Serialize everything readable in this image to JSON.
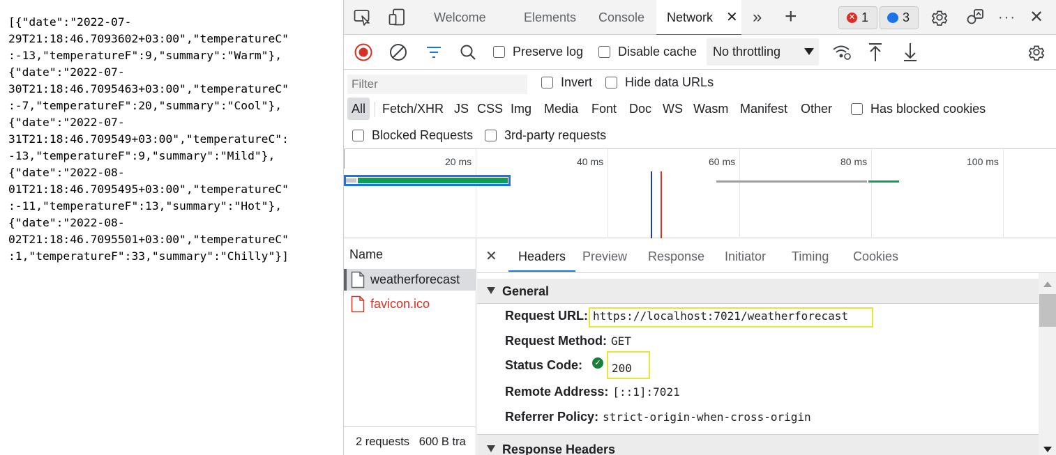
{
  "response_body": {
    "lines": [
      "[{\"date\":\"2022-07-",
      "29T21:18:46.7093602+03:00\",\"temperatureC\"",
      ":-13,\"temperatureF\":9,\"summary\":\"Warm\"},",
      "{\"date\":\"2022-07-",
      "30T21:18:46.7095463+03:00\",\"temperatureC\"",
      ":-7,\"temperatureF\":20,\"summary\":\"Cool\"},",
      "{\"date\":\"2022-07-",
      "31T21:18:46.709549+03:00\",\"temperatureC\":",
      "-13,\"temperatureF\":9,\"summary\":\"Mild\"},",
      "{\"date\":\"2022-08-",
      "01T21:18:46.7095495+03:00\",\"temperatureC\"",
      ":-11,\"temperatureF\":13,\"summary\":\"Hot\"},",
      "{\"date\":\"2022-08-",
      "02T21:18:46.7095501+03:00\",\"temperatureC\"",
      ":1,\"temperatureF\":33,\"summary\":\"Chilly\"}]"
    ]
  },
  "tabs": {
    "welcome": "Welcome",
    "elements": "Elements",
    "console": "Console",
    "network": "Network",
    "more": "»",
    "add": "+"
  },
  "badges": {
    "errors": "1",
    "messages": "3"
  },
  "toolbar": {
    "preserve_log": "Preserve log",
    "disable_cache": "Disable cache",
    "throttling": "No throttling"
  },
  "filter": {
    "placeholder": "Filter",
    "invert": "Invert",
    "hide_data_urls": "Hide data URLs",
    "types": [
      "All",
      "Fetch/XHR",
      "JS",
      "CSS",
      "Img",
      "Media",
      "Font",
      "Doc",
      "WS",
      "Wasm",
      "Manifest",
      "Other"
    ],
    "has_blocked_cookies": "Has blocked cookies",
    "blocked_requests": "Blocked Requests",
    "third_party": "3rd-party requests"
  },
  "timeline": {
    "ticks": [
      "20 ms",
      "40 ms",
      "60 ms",
      "80 ms",
      "100 ms"
    ]
  },
  "request_list": {
    "header": "Name",
    "items": [
      {
        "name": "weatherforecast",
        "selected": true,
        "error": false
      },
      {
        "name": "favicon.ico",
        "selected": false,
        "error": true
      }
    ],
    "summary": "2 requests   600 B tra"
  },
  "details": {
    "close": "×",
    "tabs": [
      "Headers",
      "Preview",
      "Response",
      "Initiator",
      "Timing",
      "Cookies"
    ],
    "general_title": "General",
    "response_headers_title": "Response Headers",
    "rows": [
      {
        "key": "Request URL:",
        "value": "https://localhost:7021/weatherforecast"
      },
      {
        "key": "Request Method:",
        "value": "GET"
      },
      {
        "key": "Status Code:",
        "value": "200"
      },
      {
        "key": "Remote Address:",
        "value": "[::1]:7021"
      },
      {
        "key": "Referrer Policy:",
        "value": "strict-origin-when-cross-origin"
      }
    ]
  },
  "colors": {
    "accent": "#1a73e8",
    "record_red": "#d93025",
    "error_red": "#d93025",
    "status_green": "#188038",
    "highlight_yellow": "#e8e53a"
  }
}
